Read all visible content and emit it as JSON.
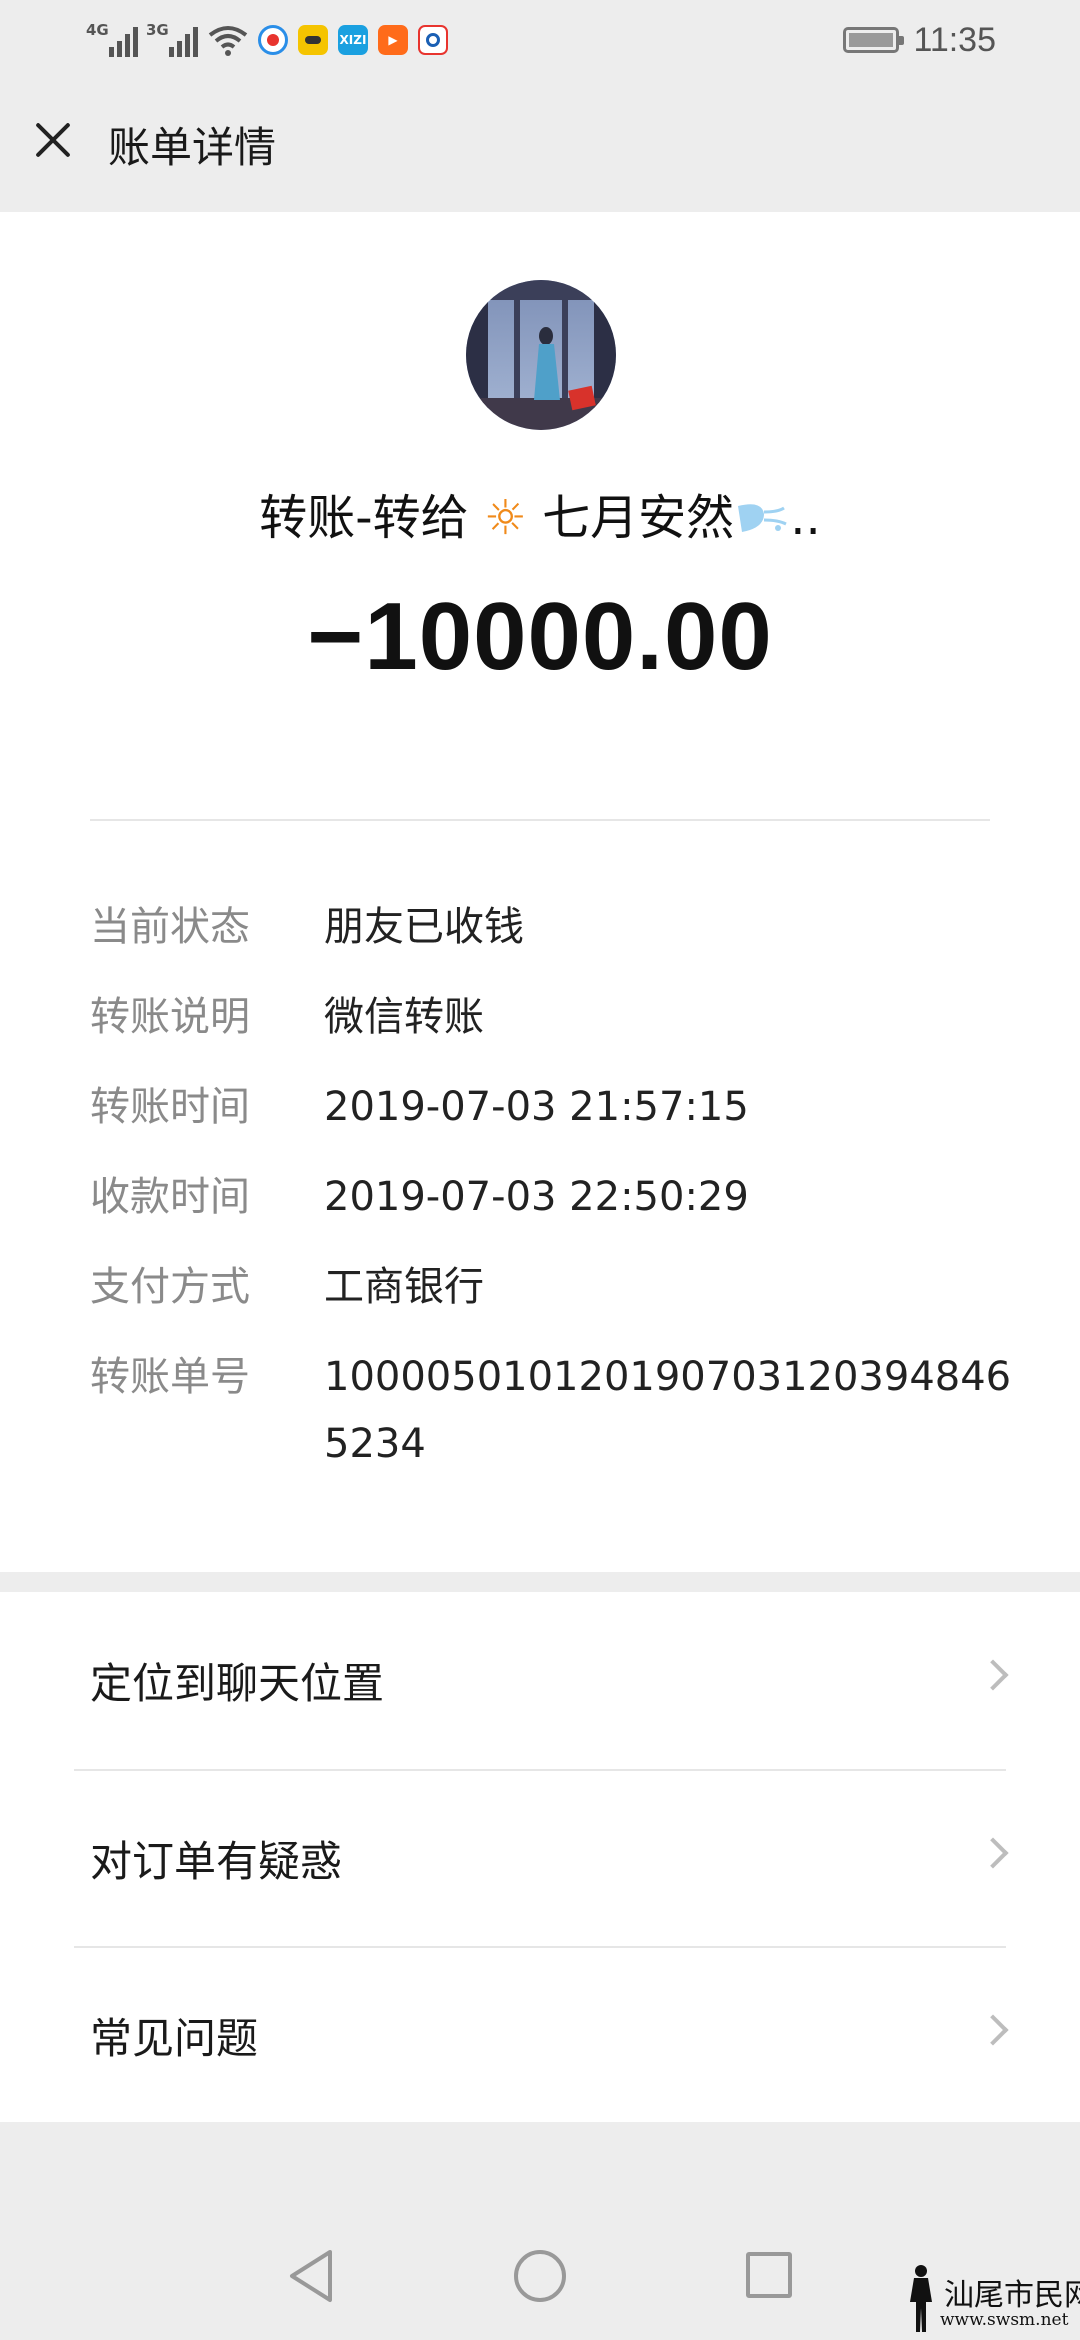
{
  "status_bar": {
    "signal1_tag": "4G",
    "signal2_tag": "3G",
    "time": "11:35",
    "apps": [
      {
        "icon": "app-icon-blue",
        "color": "#2a8ee8",
        "label": ""
      },
      {
        "icon": "app-icon-yellow",
        "color": "#f5c400",
        "label": ""
      },
      {
        "icon": "app-icon-xizi",
        "color": "#1aa0e0",
        "label": "XIZI"
      },
      {
        "icon": "app-icon-play",
        "color": "#ff6b1a",
        "label": "▶"
      },
      {
        "icon": "app-icon-red",
        "color": "#e8342e",
        "label": ""
      }
    ]
  },
  "header": {
    "title": "账单详情",
    "close_icon": "close-icon"
  },
  "detail": {
    "payee_prefix": "转账-转给",
    "payee_emoji": "☼",
    "payee_name": "七月安然",
    "payee_suffix": "..",
    "amount": "−10000.00",
    "rows": [
      {
        "label": "当前状态",
        "value": "朋友已收钱"
      },
      {
        "label": "转账说明",
        "value": "微信转账"
      },
      {
        "label": "转账时间",
        "value": "2019-07-03 21:57:15"
      },
      {
        "label": "收款时间",
        "value": "2019-07-03 22:50:29"
      },
      {
        "label": "支付方式",
        "value": "工商银行"
      },
      {
        "label": "转账单号",
        "value": "100005010120190703120394846 5234"
      }
    ]
  },
  "menu": {
    "items": [
      {
        "label": "定位到聊天位置"
      },
      {
        "label": "对订单有疑惑"
      },
      {
        "label": "常见问题"
      }
    ]
  },
  "watermark": {
    "text": "汕尾市民网",
    "url": "www.swsm.net"
  }
}
